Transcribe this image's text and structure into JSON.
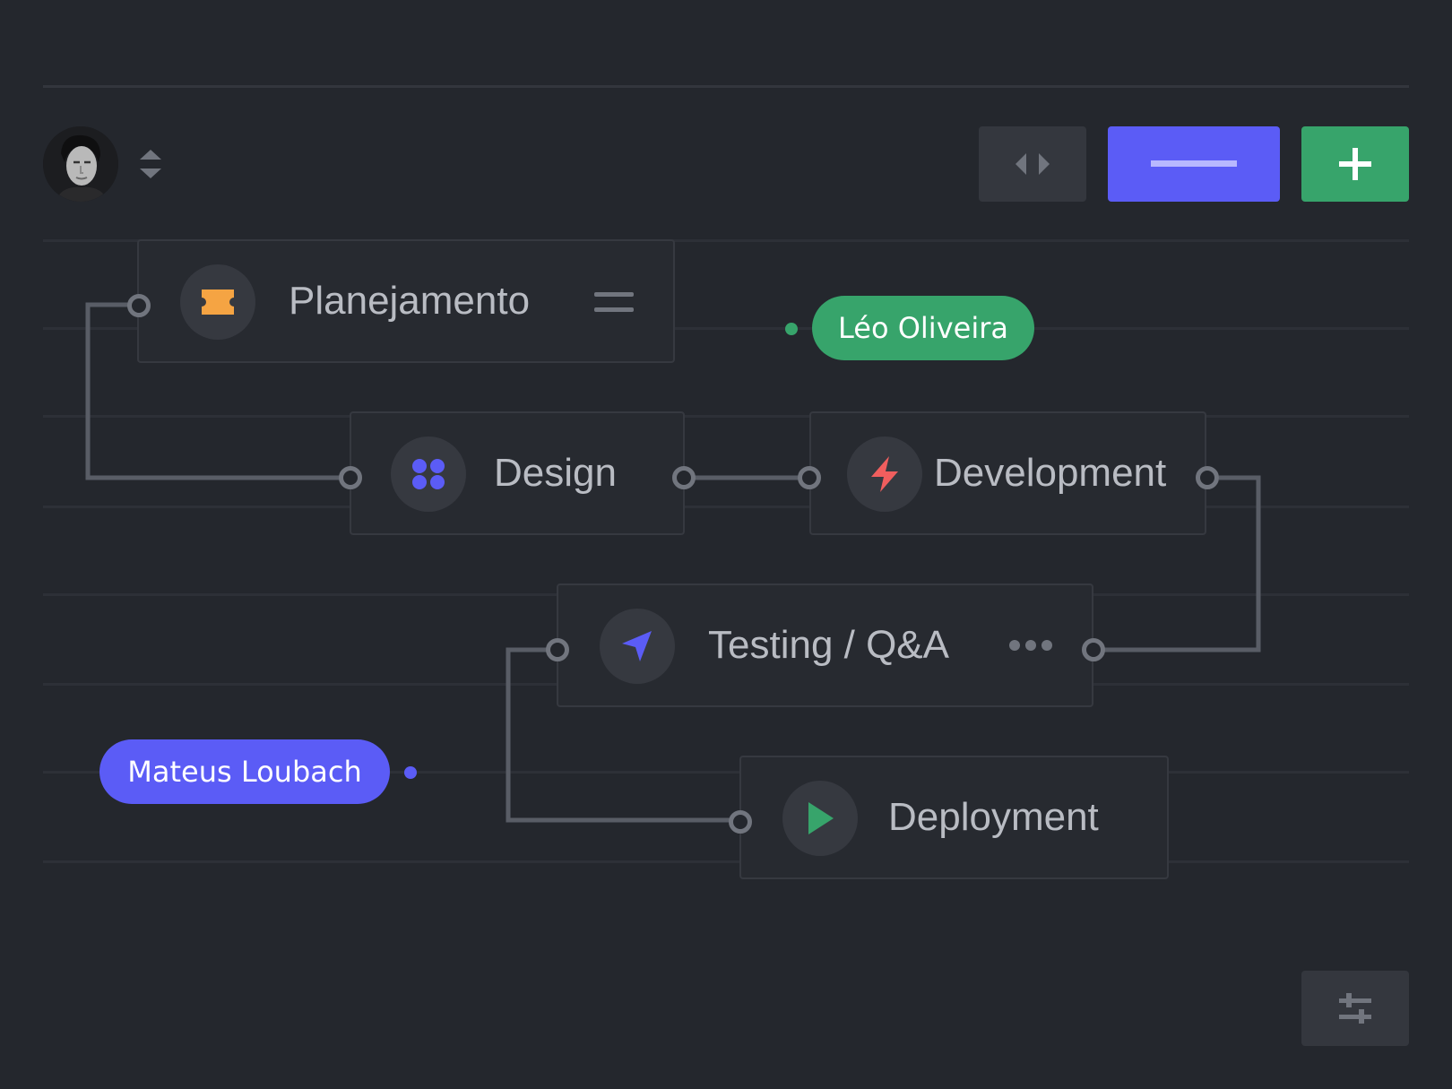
{
  "colors": {
    "background": "#24272d",
    "node_bg": "#272a30",
    "node_border": "#363940",
    "wire": "#595d66",
    "port": "#71757e",
    "accent_blue": "#5b5cf6",
    "accent_green": "#37a46b",
    "accent_orange": "#f5a443",
    "accent_red": "#f05e5e"
  },
  "header": {
    "avatar_icon": "user-avatar",
    "sort_icon": "sort-up-down-icon",
    "toolbar": {
      "code_icon": "code-arrows-icon",
      "minus_icon": "minus-icon",
      "plus_icon": "plus-icon"
    }
  },
  "nodes": [
    {
      "id": "planejamento",
      "label": "Planejamento",
      "icon": "ticket-icon",
      "icon_color": "#f5a443",
      "extra_icon": "menu-icon"
    },
    {
      "id": "design",
      "label": "Design",
      "icon": "grid-dots-icon",
      "icon_color": "#5b5cf6"
    },
    {
      "id": "development",
      "label": "Development",
      "icon": "lightning-icon",
      "icon_color": "#f05e5e"
    },
    {
      "id": "testing",
      "label": "Testing / Q&A",
      "icon": "navigation-arrow-icon",
      "icon_color": "#5b5cf6",
      "extra_icon": "more-dots-icon"
    },
    {
      "id": "deployment",
      "label": "Deployment",
      "icon": "play-icon",
      "icon_color": "#37a46b"
    }
  ],
  "users": [
    {
      "name": "Léo Oliveira",
      "color": "#37a46b"
    },
    {
      "name": "Mateus Loubach",
      "color": "#5b5cf6"
    }
  ],
  "footer": {
    "settings_icon": "sliders-icon"
  }
}
